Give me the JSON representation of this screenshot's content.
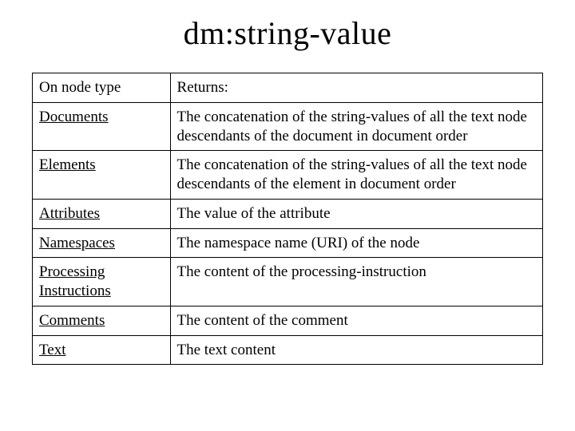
{
  "title": "dm:string-value",
  "table": {
    "header": {
      "col1": "On node type",
      "col2": "Returns:"
    },
    "rows": [
      {
        "node_type": "Documents",
        "returns": "The concatenation of the string-values of all the text node descendants of the document in document order"
      },
      {
        "node_type": "Elements",
        "returns": "The concatenation of the string-values of all the text node descendants of the element in document order"
      },
      {
        "node_type": "Attributes",
        "returns": "The value of the attribute"
      },
      {
        "node_type": "Namespaces",
        "returns": "The namespace name (URI) of the node"
      },
      {
        "node_type": "Processing Instructions",
        "returns": "The content of the processing-instruction"
      },
      {
        "node_type": "Comments",
        "returns": "The content of the comment"
      },
      {
        "node_type": "Text",
        "returns": "The text content"
      }
    ]
  }
}
